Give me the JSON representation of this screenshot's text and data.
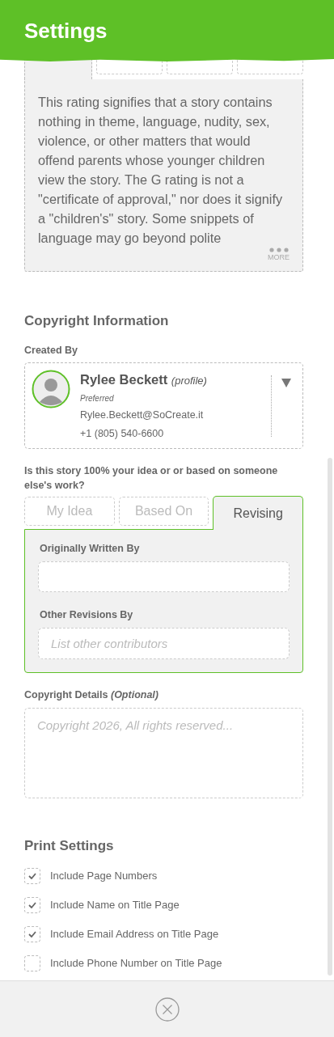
{
  "header": {
    "title": "Settings"
  },
  "rating": {
    "tabs": [
      {
        "selected": true
      },
      {
        "selected": false
      },
      {
        "selected": false
      },
      {
        "selected": false
      }
    ],
    "description": "This rating signifies that a story contains nothing in theme, language, nudity, sex, violence, or other matters that would offend parents whose younger children view the story. The G rating is not a \"certificate of approval,\" nor does it signify a \"children's\" story. Some snippets of language may go beyond polite",
    "more": "MORE"
  },
  "copyright": {
    "heading": "Copyright Information",
    "created_by": "Created By",
    "profile": {
      "name": "Rylee Beckett",
      "tag": "(profile)",
      "preferred": "Preferred",
      "email": "Rylee.Beckett@SoCreate.it",
      "phone": "+1 (805) 540-6600"
    },
    "question": "Is this story 100% your idea or or based on someone else's work?",
    "origin_tabs": [
      {
        "label": "My Idea",
        "selected": false
      },
      {
        "label": "Based On",
        "selected": false
      },
      {
        "label": "Revising",
        "selected": true
      }
    ],
    "originally_written_by": {
      "label": "Originally Written By"
    },
    "other_revisions": {
      "label": "Other Revisions By",
      "placeholder": "List other contributors"
    },
    "details": {
      "label": "Copyright Details",
      "optional": "(Optional)",
      "placeholder": "Copyright 2026, All rights reserved..."
    }
  },
  "print": {
    "heading": "Print Settings",
    "options": [
      {
        "label": "Include Page Numbers",
        "checked": true
      },
      {
        "label": "Include Name on Title Page",
        "checked": true
      },
      {
        "label": "Include Email Address on Title Page",
        "checked": true
      },
      {
        "label": "Include Phone Number on Title Page",
        "checked": false
      }
    ]
  }
}
